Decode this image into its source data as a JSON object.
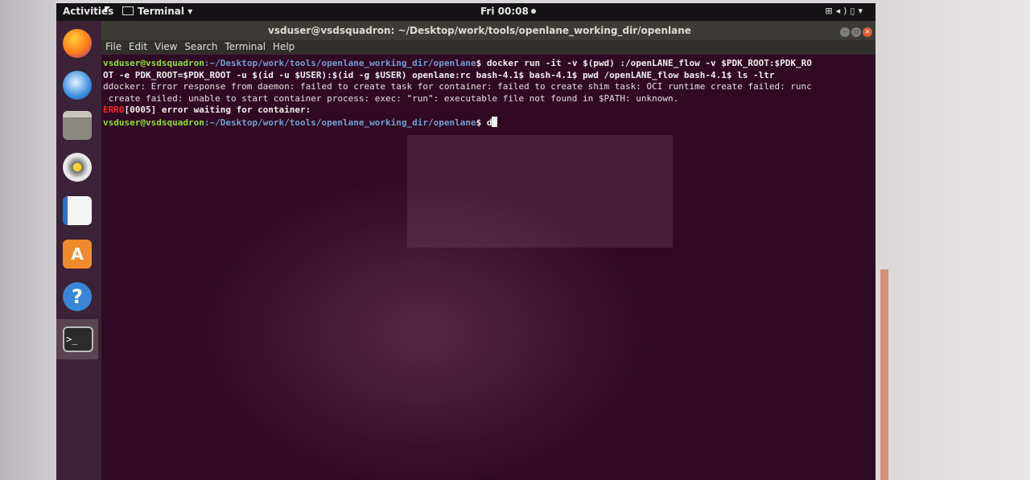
{
  "topbar": {
    "activities": "Activities",
    "app_name": "Terminal",
    "clock": "Fri 00:08",
    "tray_icons": [
      "network-icon",
      "volume-icon",
      "battery-icon",
      "chevron-down-icon"
    ]
  },
  "window": {
    "title": "vsduser@vsdsquadron: ~/Desktop/work/tools/openlane_working_dir/openlane"
  },
  "menu": [
    "File",
    "Edit",
    "View",
    "Search",
    "Terminal",
    "Help"
  ],
  "dock": [
    "firefox-icon",
    "thunderbird-icon",
    "files-icon",
    "rhythmbox-icon",
    "libreoffice-writer-icon",
    "software-store-icon",
    "help-icon",
    "terminal-icon"
  ],
  "terminal": {
    "prompt_user": "vsduser@vsdsquadron",
    "prompt_path": ":~/Desktop/work/tools/openlane_working_dir/openlane",
    "prompt_sign": "$ ",
    "command_1": "docker run -it -v $(pwd) :/openLANE_flow -v $PDK_ROOT:$PDK_RO",
    "command_2": "OT -e PDK_ROOT=$PDK_ROOT -u $(id -u $USER):$(id -g $USER) openlane:rc bash-4.1$ bash-4.1$ pwd /openLANE_flow bash-4.1$ ls -ltr",
    "output_1": "ddocker: Error response from daemon: failed to create task for container: failed to create shim task: OCI runtime create failed: runc",
    "output_2": " create failed: unable to start container process: exec: \"run\": executable file not found in $PATH: unknown.",
    "error_tag": "ERRO",
    "error_rest": "[0005] error waiting for container:",
    "current_input": "d"
  },
  "colors": {
    "terminal_bg": "#300a24",
    "prompt_user": "#8ae234",
    "prompt_path": "#729fcf",
    "error": "#ef2929",
    "topbar": "#141214"
  }
}
